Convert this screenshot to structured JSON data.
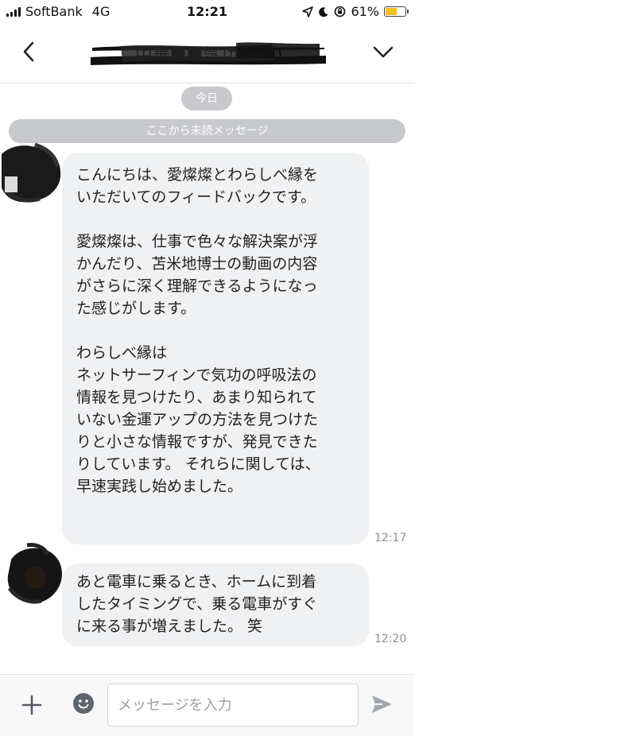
{
  "status_bar": {
    "carrier": "SoftBank",
    "network": "4G",
    "time": "12:21",
    "battery_percent": "61%",
    "battery_level": 0.61,
    "battery_color": "#f0c020"
  },
  "header": {
    "title": "中華■■気功2020",
    "back_icon": "chevron-left-icon",
    "dropdown_icon": "chevron-down-icon"
  },
  "chat": {
    "date_label": "今日",
    "unread_label": "ここから未読メッセージ",
    "messages": [
      {
        "text": "こんにちは、愛燦燦とわらしべ縁を\nいただいてのフィードバックです。\n\n愛燦燦は、仕事で色々な解決案が浮\nかんだり、苫米地博士の動画の内容\nがさらに深く理解できるようになっ\nた感じがします。\n\nわらしべ縁は\nネットサーフィンで気功の呼吸法の\n情報を見つけたり、あまり知られて\nいない金運アップの方法を見つけた\nりと小さな情報ですが、発見できた\nりしています。 それらに関しては、\n早速実践し始めました。",
        "time": "12:17"
      },
      {
        "text": "あと電車に乗るとき、ホームに到着\nしたタイミングで、乗る電車がすぐ\nに来る事が増えました。 笑",
        "time": "12:20"
      }
    ]
  },
  "input_bar": {
    "placeholder": "メッセージを入力",
    "plus_icon": "plus-icon",
    "emoji_icon": "emoji-icon",
    "send_icon": "send-icon"
  },
  "colors": {
    "bubble_bg": "#f0f1f3",
    "pill_bg": "#c7c9cc",
    "send_icon": "#a2a6ae"
  }
}
